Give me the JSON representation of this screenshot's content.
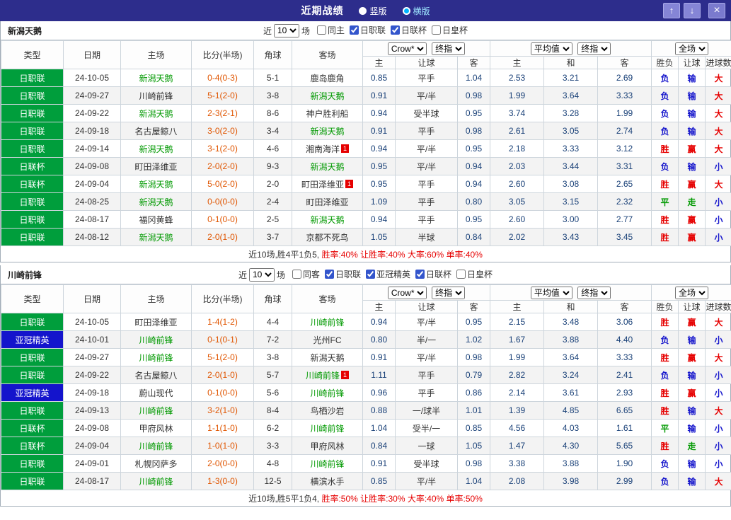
{
  "colors": {
    "titlebar_bg": "#2d2d8c",
    "focus_team": "#009900",
    "score": "#e05500",
    "odds": "#1a4178",
    "result_map": {
      "胜": "#e60000",
      "负": "#1515cc",
      "平": "#009900",
      "赢": "#e60000",
      "输": "#1515cc",
      "走": "#009900",
      "大": "#e60000",
      "小": "#1515cc"
    },
    "league_map": {
      "日职联": "#009e3c",
      "日联杯": "#009e3c",
      "亚冠精英": "#1414cc"
    }
  },
  "titlebar": {
    "title": "近期战绩",
    "layout_options": [
      {
        "label": "竖版",
        "selected": false
      },
      {
        "label": "横版",
        "selected": true
      }
    ],
    "up_button": "↑",
    "down_button": "↓",
    "close_button": "×"
  },
  "filter_labels": {
    "near": "近",
    "games": "场"
  },
  "columns": {
    "type": "类型",
    "date": "日期",
    "home": "主场",
    "score": "比分(半场)",
    "corner": "角球",
    "away": "客场",
    "h": "主",
    "handicap": "让球",
    "a": "客",
    "draw": "和",
    "wl": "胜负",
    "goals": "进球数"
  },
  "selects": {
    "bookmaker": "Crow*",
    "stage": "终指",
    "average": "平均值",
    "fullmatch": "全场"
  },
  "sections": [
    {
      "team": "新潟天鹅",
      "count": "10",
      "filters": [
        {
          "label": "同主",
          "checked": false
        },
        {
          "label": "日职联",
          "checked": true
        },
        {
          "label": "日联杯",
          "checked": true
        },
        {
          "label": "日皇杯",
          "checked": false
        }
      ],
      "rows": [
        {
          "league": "日职联",
          "date": "24-10-05",
          "home": "新潟天鹅",
          "home_focus": true,
          "home_card": "",
          "score": "0-4(0-3)",
          "corner": "5-1",
          "away": "鹿岛鹿角",
          "away_focus": false,
          "away_card": "",
          "odds_home": "0.85",
          "handicap": "平手",
          "odds_away": "1.04",
          "avg_home": "2.53",
          "avg_draw": "3.21",
          "avg_away": "2.69",
          "result": "负",
          "handicap_result": "输",
          "goals_result": "大"
        },
        {
          "league": "日职联",
          "date": "24-09-27",
          "home": "川崎前锋",
          "home_focus": false,
          "home_card": "",
          "score": "5-1(2-0)",
          "corner": "3-8",
          "away": "新潟天鹅",
          "away_focus": true,
          "away_card": "",
          "odds_home": "0.91",
          "handicap": "平/半",
          "odds_away": "0.98",
          "avg_home": "1.99",
          "avg_draw": "3.64",
          "avg_away": "3.33",
          "result": "负",
          "handicap_result": "输",
          "goals_result": "大"
        },
        {
          "league": "日职联",
          "date": "24-09-22",
          "home": "新潟天鹅",
          "home_focus": true,
          "home_card": "",
          "score": "2-3(2-1)",
          "corner": "8-6",
          "away": "神户胜利船",
          "away_focus": false,
          "away_card": "",
          "odds_home": "0.94",
          "handicap": "受半球",
          "odds_away": "0.95",
          "avg_home": "3.74",
          "avg_draw": "3.28",
          "avg_away": "1.99",
          "result": "负",
          "handicap_result": "输",
          "goals_result": "大"
        },
        {
          "league": "日职联",
          "date": "24-09-18",
          "home": "名古屋鲸八",
          "home_focus": false,
          "home_card": "",
          "score": "3-0(2-0)",
          "corner": "3-4",
          "away": "新潟天鹅",
          "away_focus": true,
          "away_card": "",
          "odds_home": "0.91",
          "handicap": "平手",
          "odds_away": "0.98",
          "avg_home": "2.61",
          "avg_draw": "3.05",
          "avg_away": "2.74",
          "result": "负",
          "handicap_result": "输",
          "goals_result": "大"
        },
        {
          "league": "日职联",
          "date": "24-09-14",
          "home": "新潟天鹅",
          "home_focus": true,
          "home_card": "",
          "score": "3-1(2-0)",
          "corner": "4-6",
          "away": "湘南海洋",
          "away_focus": false,
          "away_card": "1",
          "odds_home": "0.94",
          "handicap": "平/半",
          "odds_away": "0.95",
          "avg_home": "2.18",
          "avg_draw": "3.33",
          "avg_away": "3.12",
          "result": "胜",
          "handicap_result": "赢",
          "goals_result": "大"
        },
        {
          "league": "日联杯",
          "date": "24-09-08",
          "home": "町田泽维亚",
          "home_focus": false,
          "home_card": "",
          "score": "2-0(2-0)",
          "corner": "9-3",
          "away": "新潟天鹅",
          "away_focus": true,
          "away_card": "",
          "odds_home": "0.95",
          "handicap": "平/半",
          "odds_away": "0.94",
          "avg_home": "2.03",
          "avg_draw": "3.44",
          "avg_away": "3.31",
          "result": "负",
          "handicap_result": "输",
          "goals_result": "小"
        },
        {
          "league": "日联杯",
          "date": "24-09-04",
          "home": "新潟天鹅",
          "home_focus": true,
          "home_card": "",
          "score": "5-0(2-0)",
          "corner": "2-0",
          "away": "町田泽维亚",
          "away_focus": false,
          "away_card": "1",
          "odds_home": "0.95",
          "handicap": "平手",
          "odds_away": "0.94",
          "avg_home": "2.60",
          "avg_draw": "3.08",
          "avg_away": "2.65",
          "result": "胜",
          "handicap_result": "赢",
          "goals_result": "大"
        },
        {
          "league": "日职联",
          "date": "24-08-25",
          "home": "新潟天鹅",
          "home_focus": true,
          "home_card": "",
          "score": "0-0(0-0)",
          "corner": "2-4",
          "away": "町田泽维亚",
          "away_focus": false,
          "away_card": "",
          "odds_home": "1.09",
          "handicap": "平手",
          "odds_away": "0.80",
          "avg_home": "3.05",
          "avg_draw": "3.15",
          "avg_away": "2.32",
          "result": "平",
          "handicap_result": "走",
          "goals_result": "小"
        },
        {
          "league": "日职联",
          "date": "24-08-17",
          "home": "福冈黄蜂",
          "home_focus": false,
          "home_card": "",
          "score": "0-1(0-0)",
          "corner": "2-5",
          "away": "新潟天鹅",
          "away_focus": true,
          "away_card": "",
          "odds_home": "0.94",
          "handicap": "平手",
          "odds_away": "0.95",
          "avg_home": "2.60",
          "avg_draw": "3.00",
          "avg_away": "2.77",
          "result": "胜",
          "handicap_result": "赢",
          "goals_result": "小"
        },
        {
          "league": "日职联",
          "date": "24-08-12",
          "home": "新潟天鹅",
          "home_focus": true,
          "home_card": "",
          "score": "2-0(1-0)",
          "corner": "3-7",
          "away": "京都不死鸟",
          "away_focus": false,
          "away_card": "",
          "odds_home": "1.05",
          "handicap": "半球",
          "odds_away": "0.84",
          "avg_home": "2.02",
          "avg_draw": "3.43",
          "avg_away": "3.45",
          "result": "胜",
          "handicap_result": "赢",
          "goals_result": "小"
        }
      ],
      "summary": [
        {
          "text": "近10场,胜4平1负5, ",
          "color": "#333333"
        },
        {
          "text": "胜率:40% ",
          "color": "#e60000"
        },
        {
          "text": "让胜率:40% ",
          "color": "#e60000"
        },
        {
          "text": "大率:60% ",
          "color": "#e60000"
        },
        {
          "text": "单率:40%",
          "color": "#e60000"
        }
      ]
    },
    {
      "team": "川崎前锋",
      "count": "10",
      "filters": [
        {
          "label": "同客",
          "checked": false
        },
        {
          "label": "日职联",
          "checked": true
        },
        {
          "label": "亚冠精英",
          "checked": true
        },
        {
          "label": "日联杯",
          "checked": true
        },
        {
          "label": "日皇杯",
          "checked": false
        }
      ],
      "rows": [
        {
          "league": "日职联",
          "date": "24-10-05",
          "home": "町田泽维亚",
          "home_focus": false,
          "home_card": "",
          "score": "1-4(1-2)",
          "corner": "4-4",
          "away": "川崎前锋",
          "away_focus": true,
          "away_card": "",
          "odds_home": "0.94",
          "handicap": "平/半",
          "odds_away": "0.95",
          "avg_home": "2.15",
          "avg_draw": "3.48",
          "avg_away": "3.06",
          "result": "胜",
          "handicap_result": "赢",
          "goals_result": "大"
        },
        {
          "league": "亚冠精英",
          "date": "24-10-01",
          "home": "川崎前锋",
          "home_focus": true,
          "home_card": "",
          "score": "0-1(0-1)",
          "corner": "7-2",
          "away": "光州FC",
          "away_focus": false,
          "away_card": "",
          "odds_home": "0.80",
          "handicap": "半/一",
          "odds_away": "1.02",
          "avg_home": "1.67",
          "avg_draw": "3.88",
          "avg_away": "4.40",
          "result": "负",
          "handicap_result": "输",
          "goals_result": "小"
        },
        {
          "league": "日职联",
          "date": "24-09-27",
          "home": "川崎前锋",
          "home_focus": true,
          "home_card": "",
          "score": "5-1(2-0)",
          "corner": "3-8",
          "away": "新潟天鹅",
          "away_focus": false,
          "away_card": "",
          "odds_home": "0.91",
          "handicap": "平/半",
          "odds_away": "0.98",
          "avg_home": "1.99",
          "avg_draw": "3.64",
          "avg_away": "3.33",
          "result": "胜",
          "handicap_result": "赢",
          "goals_result": "大"
        },
        {
          "league": "日职联",
          "date": "24-09-22",
          "home": "名古屋鲸八",
          "home_focus": false,
          "home_card": "",
          "score": "2-0(1-0)",
          "corner": "5-7",
          "away": "川崎前锋",
          "away_focus": true,
          "away_card": "1",
          "odds_home": "1.11",
          "handicap": "平手",
          "odds_away": "0.79",
          "avg_home": "2.82",
          "avg_draw": "3.24",
          "avg_away": "2.41",
          "result": "负",
          "handicap_result": "输",
          "goals_result": "小"
        },
        {
          "league": "亚冠精英",
          "date": "24-09-18",
          "home": "蔚山现代",
          "home_focus": false,
          "home_card": "",
          "score": "0-1(0-0)",
          "corner": "5-6",
          "away": "川崎前锋",
          "away_focus": true,
          "away_card": "",
          "odds_home": "0.96",
          "handicap": "平手",
          "odds_away": "0.86",
          "avg_home": "2.14",
          "avg_draw": "3.61",
          "avg_away": "2.93",
          "result": "胜",
          "handicap_result": "赢",
          "goals_result": "小"
        },
        {
          "league": "日职联",
          "date": "24-09-13",
          "home": "川崎前锋",
          "home_focus": true,
          "home_card": "",
          "score": "3-2(1-0)",
          "corner": "8-4",
          "away": "鸟栖沙岩",
          "away_focus": false,
          "away_card": "",
          "odds_home": "0.88",
          "handicap": "一/球半",
          "odds_away": "1.01",
          "avg_home": "1.39",
          "avg_draw": "4.85",
          "avg_away": "6.65",
          "result": "胜",
          "handicap_result": "输",
          "goals_result": "大"
        },
        {
          "league": "日联杯",
          "date": "24-09-08",
          "home": "甲府风林",
          "home_focus": false,
          "home_card": "",
          "score": "1-1(1-0)",
          "corner": "6-2",
          "away": "川崎前锋",
          "away_focus": true,
          "away_card": "",
          "odds_home": "1.04",
          "handicap": "受半/一",
          "odds_away": "0.85",
          "avg_home": "4.56",
          "avg_draw": "4.03",
          "avg_away": "1.61",
          "result": "平",
          "handicap_result": "输",
          "goals_result": "小"
        },
        {
          "league": "日联杯",
          "date": "24-09-04",
          "home": "川崎前锋",
          "home_focus": true,
          "home_card": "",
          "score": "1-0(1-0)",
          "corner": "3-3",
          "away": "甲府风林",
          "away_focus": false,
          "away_card": "",
          "odds_home": "0.84",
          "handicap": "一球",
          "odds_away": "1.05",
          "avg_home": "1.47",
          "avg_draw": "4.30",
          "avg_away": "5.65",
          "result": "胜",
          "handicap_result": "走",
          "goals_result": "小"
        },
        {
          "league": "日职联",
          "date": "24-09-01",
          "home": "札幌冈萨多",
          "home_focus": false,
          "home_card": "",
          "score": "2-0(0-0)",
          "corner": "4-8",
          "away": "川崎前锋",
          "away_focus": true,
          "away_card": "",
          "odds_home": "0.91",
          "handicap": "受半球",
          "odds_away": "0.98",
          "avg_home": "3.38",
          "avg_draw": "3.88",
          "avg_away": "1.90",
          "result": "负",
          "handicap_result": "输",
          "goals_result": "小"
        },
        {
          "league": "日职联",
          "date": "24-08-17",
          "home": "川崎前锋",
          "home_focus": true,
          "home_card": "",
          "score": "1-3(0-0)",
          "corner": "12-5",
          "away": "横滨水手",
          "away_focus": false,
          "away_card": "",
          "odds_home": "0.85",
          "handicap": "平/半",
          "odds_away": "1.04",
          "avg_home": "2.08",
          "avg_draw": "3.98",
          "avg_away": "2.99",
          "result": "负",
          "handicap_result": "输",
          "goals_result": "大"
        }
      ],
      "summary": [
        {
          "text": "近10场,胜5平1负4, ",
          "color": "#333333"
        },
        {
          "text": "胜率:50% ",
          "color": "#e60000"
        },
        {
          "text": "让胜率:30% ",
          "color": "#e60000"
        },
        {
          "text": "大率:40% ",
          "color": "#e60000"
        },
        {
          "text": "单率:50%",
          "color": "#e60000"
        }
      ]
    }
  ]
}
